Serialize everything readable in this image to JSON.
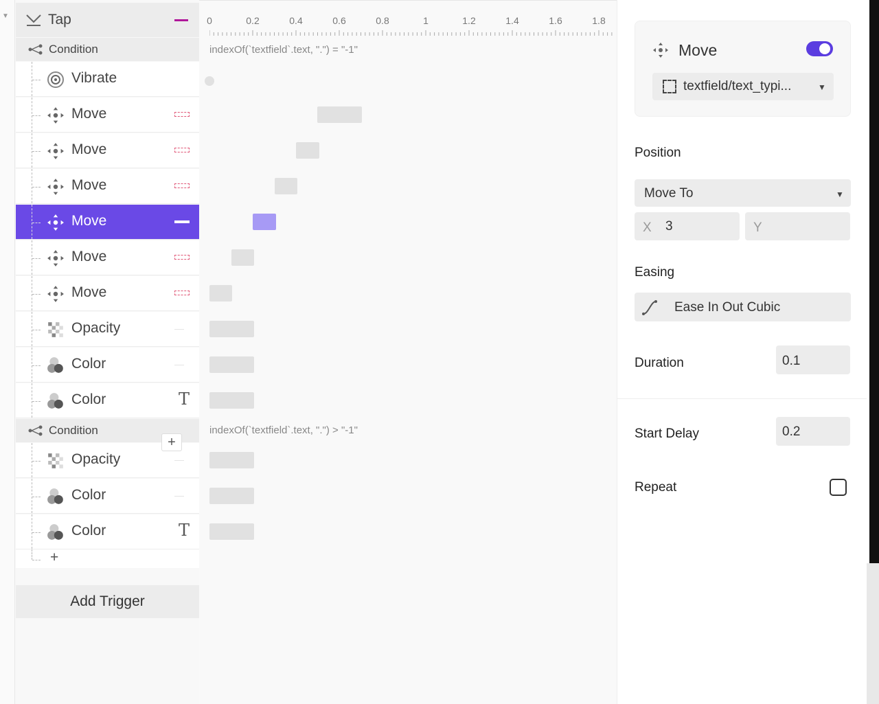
{
  "trigger": {
    "label": "Tap"
  },
  "conditions": [
    {
      "label": "Condition",
      "expression": "indexOf(`textfield`.text, \".\") = \"-1\""
    },
    {
      "label": "Condition",
      "expression": "indexOf(`textfield`.text, \".\") > \"-1\""
    }
  ],
  "items": [
    {
      "label": "Vibrate",
      "icon": "vibrate-icon"
    },
    {
      "label": "Move",
      "icon": "move-icon"
    },
    {
      "label": "Move",
      "icon": "move-icon"
    },
    {
      "label": "Move",
      "icon": "move-icon"
    },
    {
      "label": "Move",
      "icon": "move-icon",
      "selected": true
    },
    {
      "label": "Move",
      "icon": "move-icon"
    },
    {
      "label": "Move",
      "icon": "move-icon"
    },
    {
      "label": "Opacity",
      "icon": "opacity-icon"
    },
    {
      "label": "Color",
      "icon": "color-icon"
    },
    {
      "label": "Color",
      "icon": "color-icon",
      "type_glyph": "T"
    },
    {
      "label": "Opacity",
      "icon": "opacity-icon"
    },
    {
      "label": "Color",
      "icon": "color-icon"
    },
    {
      "label": "Color",
      "icon": "color-icon",
      "type_glyph": "T"
    }
  ],
  "add_item_symbol": "+",
  "condition_add_symbol": "+",
  "add_trigger_label": "Add Trigger",
  "timeline": {
    "ticks": [
      "0",
      "0.2",
      "0.4",
      "0.6",
      "0.8",
      "1",
      "1.2",
      "1.4",
      "1.6",
      "1.8"
    ]
  },
  "inspector": {
    "title": "Move",
    "enabled": true,
    "target": "textfield/text_typi...",
    "position_label": "Position",
    "position_mode": "Move To",
    "x_label": "X",
    "x_value": "3",
    "y_label": "Y",
    "easing_label": "Easing",
    "easing_value": "Ease In Out Cubic",
    "duration_label": "Duration",
    "duration_value": "0.1",
    "start_delay_label": "Start Delay",
    "start_delay_value": "0.2",
    "repeat_label": "Repeat",
    "repeat_checked": false
  },
  "colors": {
    "accent": "#6a49e6",
    "selected_bar": "#a79af5",
    "toggle": "#5b3de0",
    "trigger_mark": "#b0179a",
    "dashed_mark": "#e05777"
  }
}
